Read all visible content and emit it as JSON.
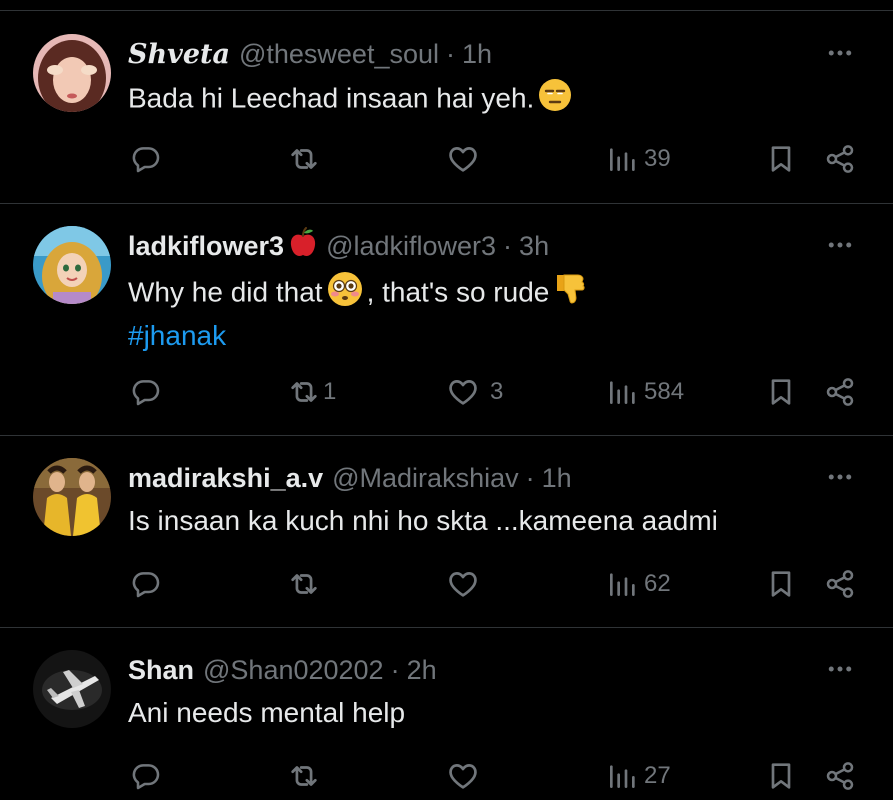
{
  "posts": [
    {
      "name": "Shveta",
      "handle": "@thesweet_soul",
      "separator": "·",
      "time": "1h",
      "text": "Bada hi Leechad insaan hai yeh.",
      "emoji": "unamused-face-emoji",
      "replies": "",
      "reposts": "",
      "likes": "",
      "views": "39"
    },
    {
      "name": "ladkiflower3",
      "name_emoji": "red-apple-emoji",
      "handle": "@ladkiflower3",
      "separator": "·",
      "time": "3h",
      "text_before": "Why he did that",
      "text_after": ", that's so rude",
      "hashtag": "#jhanak",
      "replies": "",
      "reposts": "1",
      "likes": "3",
      "views": "584"
    },
    {
      "name": "madirakshi_a.v",
      "handle": "@Madirakshiav",
      "separator": "·",
      "time": "1h",
      "text": "Is insaan ka kuch nhi ho skta ...kameena aadmi",
      "replies": "",
      "reposts": "",
      "likes": "",
      "views": "62"
    },
    {
      "name": "Shan",
      "handle": "@Shan020202",
      "separator": "·",
      "time": "2h",
      "text": "Ani needs mental help",
      "replies": "",
      "reposts": "",
      "likes": "",
      "views": "27"
    }
  ],
  "colors": {
    "background": "#000000",
    "text": "#e7e9ea",
    "secondary": "#71767b",
    "link": "#1d9bf0",
    "divider": "#2f3336"
  }
}
